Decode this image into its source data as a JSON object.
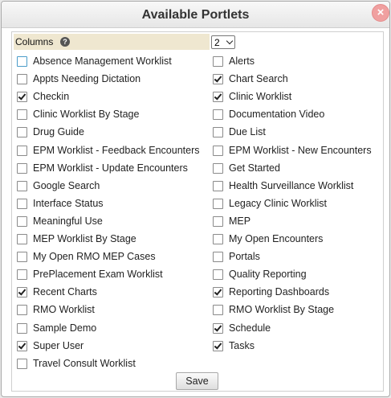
{
  "dialog": {
    "title": "Available Portlets",
    "close_label": "×"
  },
  "columns": {
    "label": "Columns",
    "help_glyph": "?",
    "selected": "2"
  },
  "portlets_left": [
    {
      "label": "Absence Management Worklist",
      "checked": false,
      "focused": true
    },
    {
      "label": "Appts Needing Dictation",
      "checked": false
    },
    {
      "label": "Checkin",
      "checked": true
    },
    {
      "label": "Clinic Worklist By Stage",
      "checked": false
    },
    {
      "label": "Drug Guide",
      "checked": false
    },
    {
      "label": "EPM Worklist - Feedback Encounters",
      "checked": false
    },
    {
      "label": "EPM Worklist - Update Encounters",
      "checked": false
    },
    {
      "label": "Google Search",
      "checked": false
    },
    {
      "label": "Interface Status",
      "checked": false
    },
    {
      "label": "Meaningful Use",
      "checked": false
    },
    {
      "label": "MEP Worklist By Stage",
      "checked": false
    },
    {
      "label": "My Open RMO MEP Cases",
      "checked": false
    },
    {
      "label": "PrePlacement Exam Worklist",
      "checked": false
    },
    {
      "label": "Recent Charts",
      "checked": true
    },
    {
      "label": "RMO Worklist",
      "checked": false
    },
    {
      "label": "Sample Demo",
      "checked": false
    },
    {
      "label": "Super User",
      "checked": true
    },
    {
      "label": "Travel Consult Worklist",
      "checked": false
    }
  ],
  "portlets_right": [
    {
      "label": "Alerts",
      "checked": false
    },
    {
      "label": "Chart Search",
      "checked": true
    },
    {
      "label": "Clinic Worklist",
      "checked": true
    },
    {
      "label": "Documentation Video",
      "checked": false
    },
    {
      "label": "Due List",
      "checked": false
    },
    {
      "label": "EPM Worklist - New Encounters",
      "checked": false
    },
    {
      "label": "Get Started",
      "checked": false
    },
    {
      "label": "Health Surveillance Worklist",
      "checked": false
    },
    {
      "label": "Legacy Clinic Worklist",
      "checked": false
    },
    {
      "label": "MEP",
      "checked": false
    },
    {
      "label": "My Open Encounters",
      "checked": false
    },
    {
      "label": "Portals",
      "checked": false
    },
    {
      "label": "Quality Reporting",
      "checked": false
    },
    {
      "label": "Reporting Dashboards",
      "checked": true
    },
    {
      "label": "RMO Worklist By Stage",
      "checked": false
    },
    {
      "label": "Schedule",
      "checked": true
    },
    {
      "label": "Tasks",
      "checked": true
    }
  ],
  "save_label": "Save"
}
